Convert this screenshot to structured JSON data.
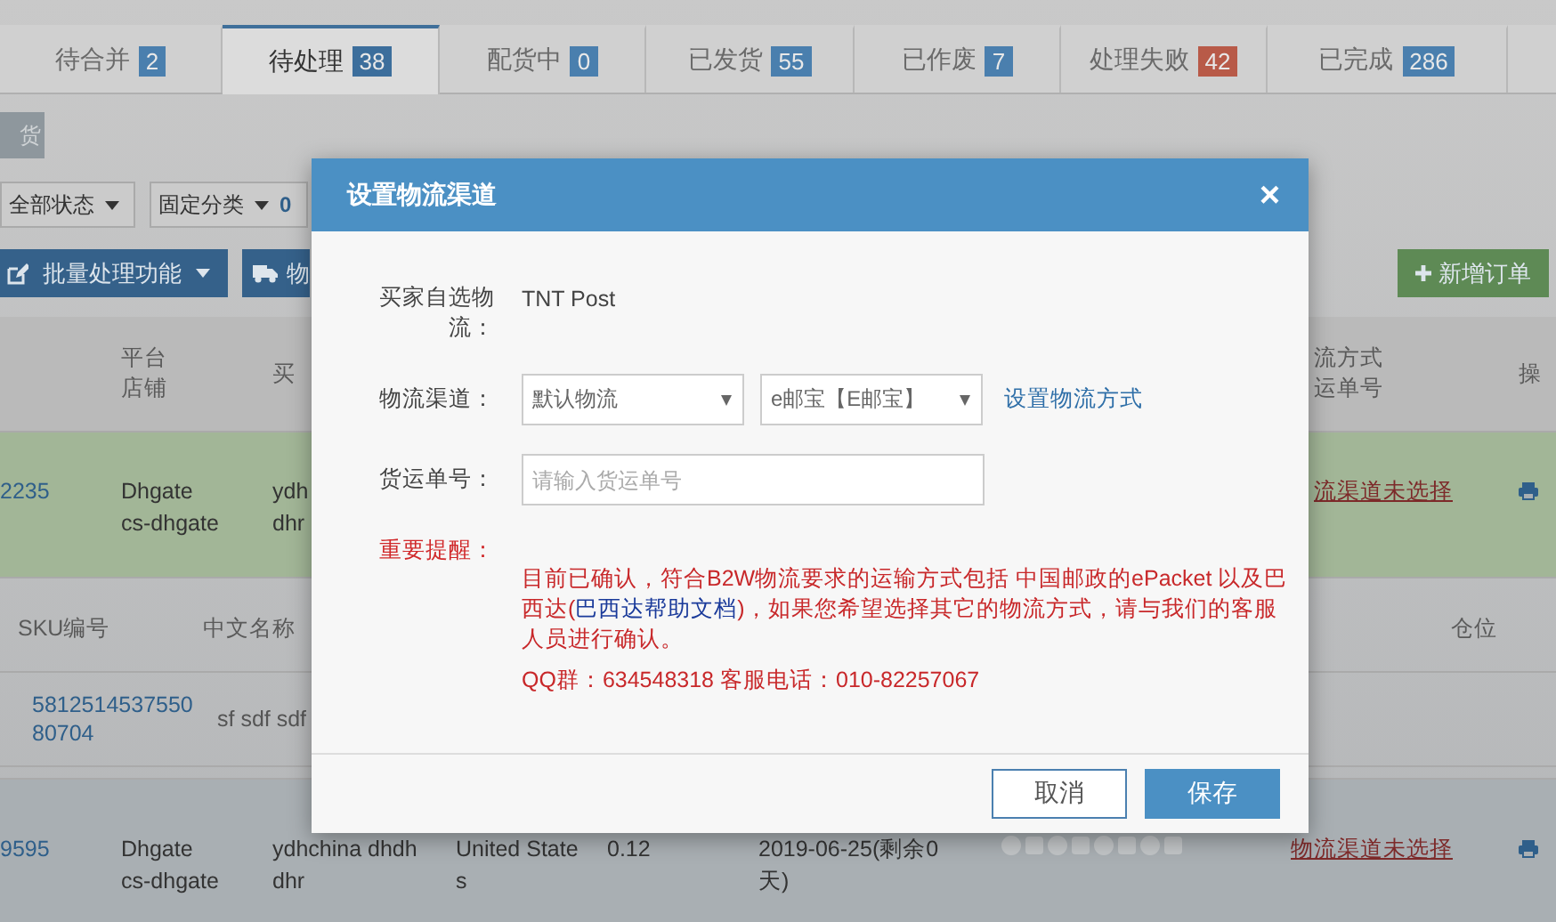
{
  "tabs": [
    {
      "label": "待合并",
      "count": "2",
      "selected": false,
      "color": "#4a7fae"
    },
    {
      "label": "待处理",
      "count": "38",
      "selected": true,
      "color": "#3c6e9c"
    },
    {
      "label": "配货中",
      "count": "0",
      "selected": false,
      "color": "#4a7fae"
    },
    {
      "label": "已发货",
      "count": "55",
      "selected": false,
      "color": "#4a7fae"
    },
    {
      "label": "已作废",
      "count": "7",
      "selected": false,
      "color": "#4a7fae"
    },
    {
      "label": "处理失败",
      "count": "42",
      "selected": false,
      "color": "#b85a48"
    },
    {
      "label": "已完成",
      "count": "286",
      "selected": false,
      "color": "#4a7fae"
    }
  ],
  "top_button": "货",
  "filters": [
    {
      "label": "全部状态"
    },
    {
      "label": "固定分类",
      "count": "0"
    }
  ],
  "actions": [
    {
      "kind": "batch",
      "label": "批量处理功能"
    },
    {
      "kind": "ship",
      "label": "物"
    }
  ],
  "new_order_button": "新增订单",
  "table": {
    "header": {
      "platform": [
        "平台",
        "店铺"
      ],
      "buyer": [
        "买"
      ],
      "shipping": [
        "流方式",
        "运单号"
      ],
      "action": [
        "操"
      ]
    },
    "rows": [
      {
        "highlighted": true,
        "order": "2235",
        "platform": [
          "Dhgate",
          "cs-dhgate"
        ],
        "buyer": [
          "ydh",
          "dhr"
        ],
        "shipping": "流渠道未选择",
        "print": true,
        "items": {
          "columns": [
            "SKU编号",
            "中文名称",
            "仓位"
          ],
          "rows": [
            {
              "sku": [
                "5812514537550",
                "80704"
              ],
              "name": "sf sdf sdf"
            }
          ]
        }
      },
      {
        "highlighted": false,
        "order": "9595",
        "platform": [
          "Dhgate",
          "cs-dhgate"
        ],
        "buyer": [
          "ydhchina dhdh",
          "dhr"
        ],
        "country": [
          "United State",
          "s"
        ],
        "amount": "0.12",
        "deadline": [
          "2019-06-25(剩余0",
          "天)"
        ],
        "status_icons": true,
        "shipping": "物流渠道未选择",
        "print": true
      }
    ]
  },
  "dialog": {
    "title": "设置物流渠道",
    "close": "×",
    "buyer_label": "买家自选物流：",
    "buyer_value": "TNT Post",
    "channel_label": "物流渠道：",
    "channel_select": "默认物流",
    "service_select": "e邮宝【E邮宝】",
    "settings_link": "设置物流方式",
    "tracking_label": "货运单号：",
    "tracking_placeholder": "请输入货运单号",
    "notice_label": "重要提醒：",
    "notice_before": "目前已确认，符合B2W物流要求的运输方式包括 中国邮政的ePacket 以及巴西达(",
    "notice_link": "巴西达帮助文档",
    "notice_after": ")，如果您希望选择其它的物流方式，请与我们的客服人员进行确认。",
    "contact": "QQ群：634548318 客服电话：010-82257067",
    "cancel": "取消",
    "save": "保存"
  }
}
